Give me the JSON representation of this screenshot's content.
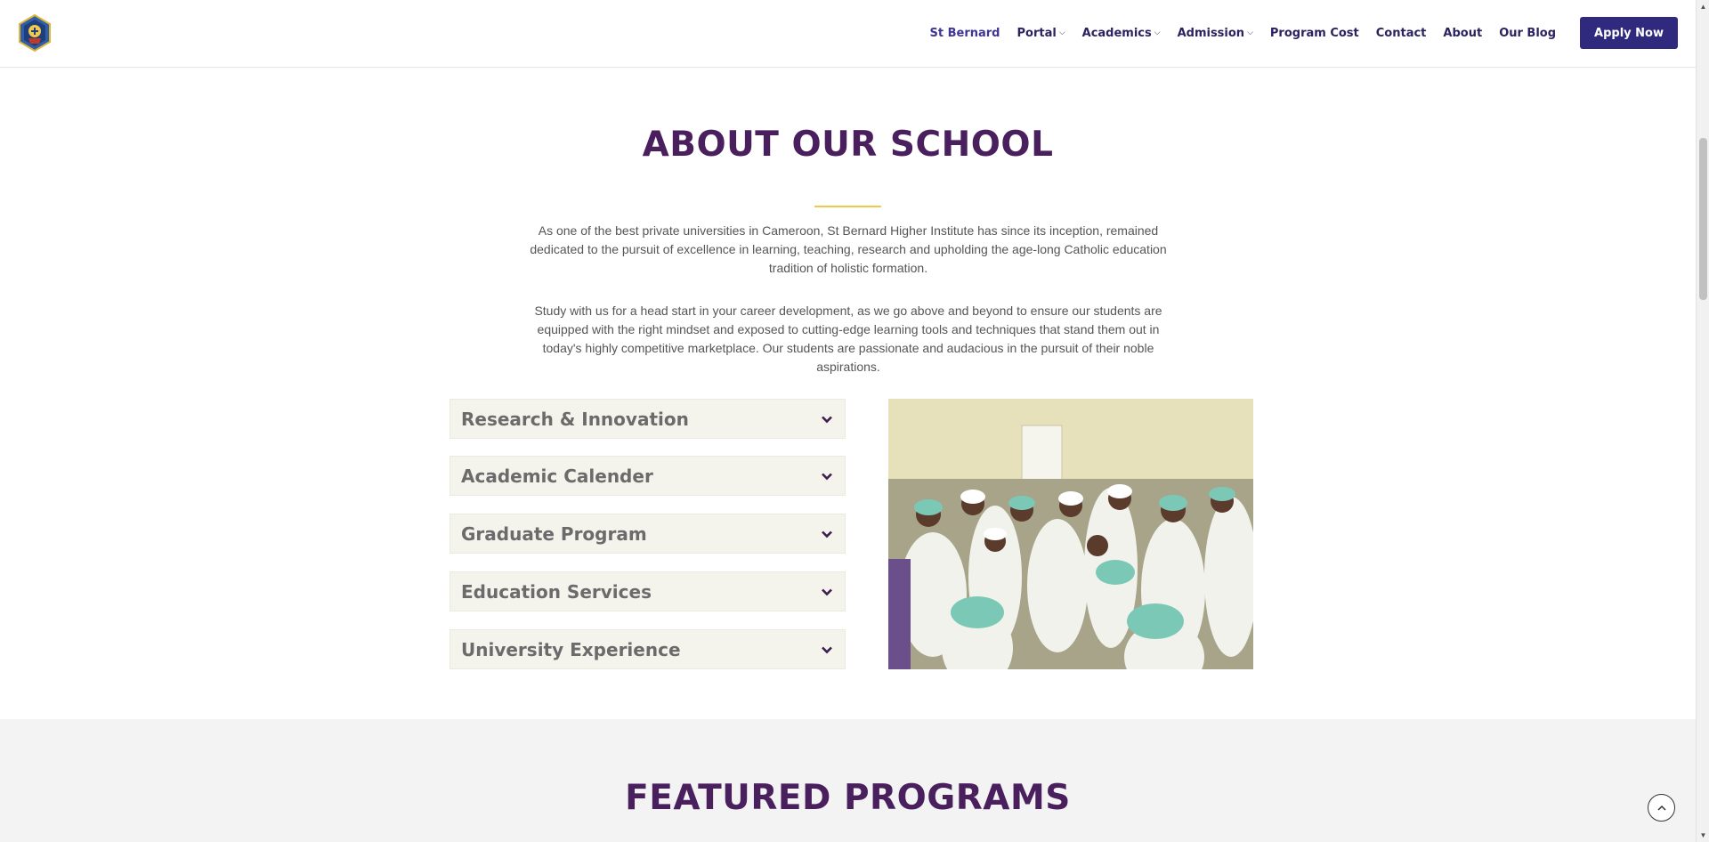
{
  "header": {
    "logo_icon": "school-crest-icon",
    "nav": [
      {
        "label": "St Bernard",
        "caret": false,
        "active": true
      },
      {
        "label": "Portal",
        "caret": true
      },
      {
        "label": "Academics",
        "caret": true
      },
      {
        "label": "Admission",
        "caret": true
      },
      {
        "label": "Program Cost",
        "caret": false
      },
      {
        "label": "Contact",
        "caret": false
      },
      {
        "label": "About",
        "caret": false
      },
      {
        "label": "Our Blog",
        "caret": false
      }
    ],
    "apply_label": "Apply Now"
  },
  "about": {
    "title": "ABOUT OUR SCHOOL",
    "paragraph1": "As one of the best private universities in Cameroon, St Bernard Higher Institute  has since its inception, remained dedicated to the pursuit of excellence in learning, teaching, research and upholding the age-long Catholic education tradition of holistic formation.",
    "paragraph2": "Study with us for a head start in your career development, as we go above and beyond to ensure our students are equipped with the right mindset and exposed to cutting-edge learning tools and techniques that stand them out in today's highly competitive marketplace. Our students are passionate and audacious in the pursuit of their noble aspirations.",
    "accordion": [
      {
        "label": "Research & Innovation"
      },
      {
        "label": "Academic Calender"
      },
      {
        "label": "Graduate Program"
      },
      {
        "label": "Education Services"
      },
      {
        "label": "University Experience"
      }
    ],
    "photo_icon": "students-lab-photo"
  },
  "featured": {
    "title": "FEATURED PROGRAMS"
  },
  "colors": {
    "brand_purple": "#4a1f5e",
    "button_indigo": "#2f2a7d",
    "accent_gold": "#f1c94a",
    "accordion_bg": "#f4f3ec"
  }
}
